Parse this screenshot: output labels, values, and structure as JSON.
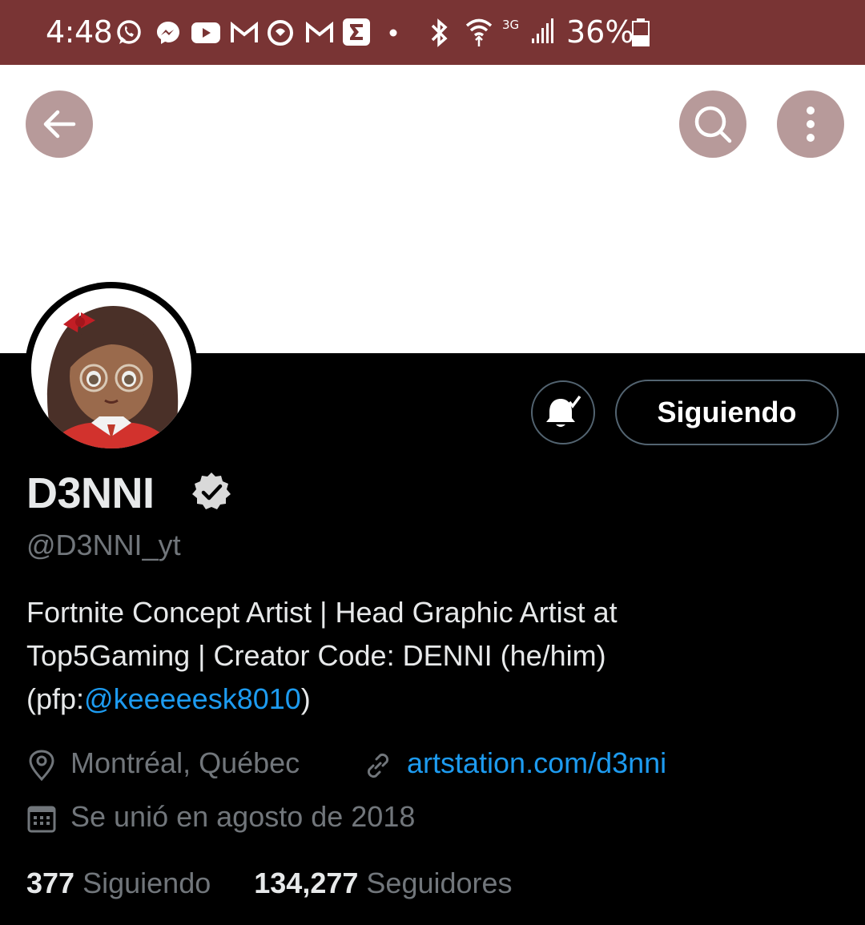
{
  "status_bar": {
    "time": "4:48",
    "network": "3G",
    "battery": "36%",
    "notification_icons": [
      "whatsapp-icon",
      "messenger-icon",
      "youtube-icon",
      "gmail-icon",
      "app-icon",
      "gmail-icon",
      "sigma-icon"
    ]
  },
  "profile": {
    "display_name": "D3NNI",
    "handle": "@D3NNI_yt",
    "bio_line1": "Fortnite Concept Artist | Head Graphic Artist at",
    "bio_line2": "Top5Gaming | Creator Code: DENNI (he/him)",
    "bio_line3_prefix": "(pfp:",
    "bio_mention": "@keeeeesk8010",
    "bio_line3_suffix": ")",
    "location": "Montréal, Québec",
    "website": "artstation.com/d3nni",
    "joined": "Se unió en agosto de 2018",
    "following_count": "377",
    "following_label": "Siguiendo",
    "followers_count": "134,277",
    "followers_label": "Seguidores"
  },
  "actions": {
    "follow_state_label": "Siguiendo"
  },
  "colors": {
    "status_bar": "#793434",
    "accent_link": "#1d9bf0",
    "nav_button_bg": "#b79a9a"
  }
}
